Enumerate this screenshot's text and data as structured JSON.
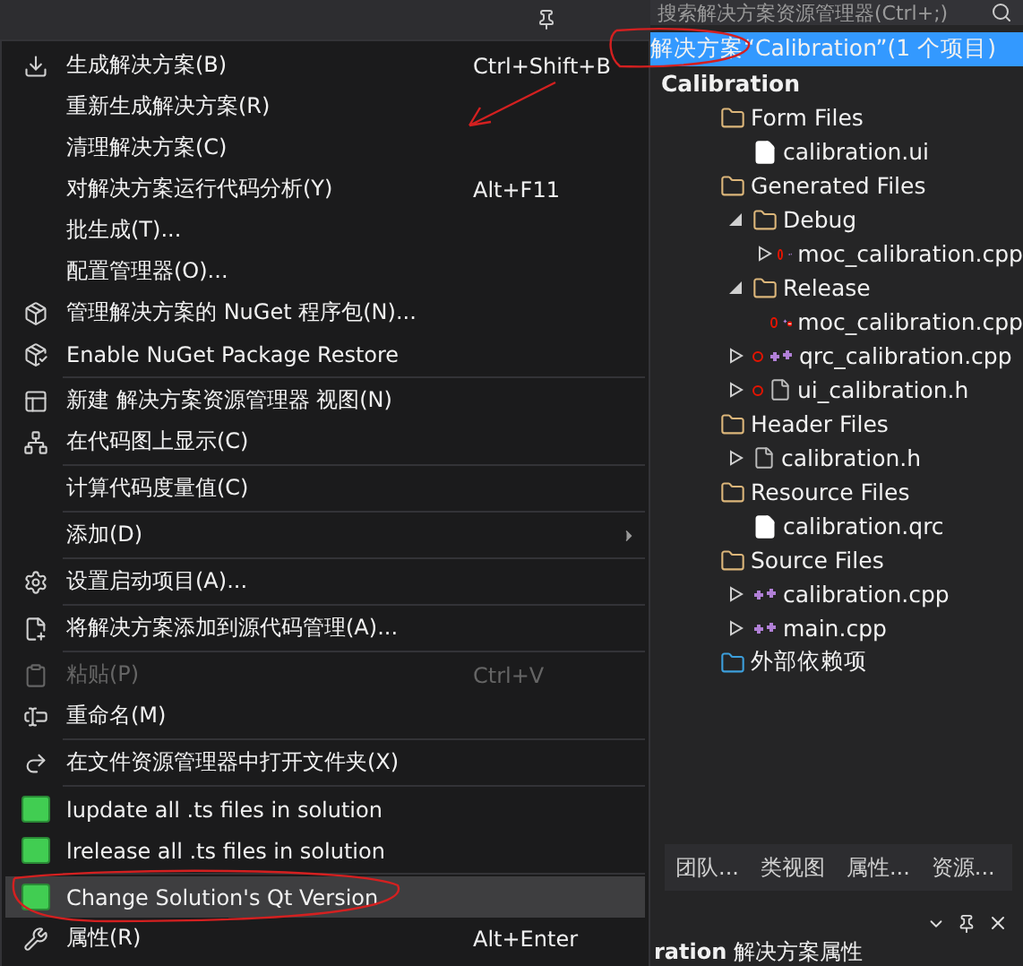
{
  "menu": {
    "items": [
      {
        "kind": "build",
        "label": "生成解决方案(B)",
        "shortcut": "Ctrl+Shift+B",
        "disabled": false,
        "selected": false
      },
      {
        "kind": "plain",
        "label": "重新生成解决方案(R)",
        "disabled": false,
        "selected": false
      },
      {
        "kind": "plain",
        "label": "清理解决方案(C)",
        "disabled": false,
        "selected": false
      },
      {
        "kind": "plain",
        "label": "对解决方案运行代码分析(Y)",
        "shortcut": "Alt+F11",
        "disabled": false,
        "selected": false
      },
      {
        "kind": "plain",
        "label": "批生成(T)...",
        "disabled": false,
        "selected": false
      },
      {
        "kind": "plain",
        "label": "配置管理器(O)...",
        "disabled": false,
        "selected": false
      },
      {
        "kind": "nuget",
        "label": "管理解决方案的 NuGet 程序包(N)...",
        "disabled": false,
        "selected": false
      },
      {
        "kind": "restore",
        "label": "Enable NuGet Package Restore",
        "disabled": false,
        "selected": false
      },
      {
        "kind": "separator"
      },
      {
        "kind": "view",
        "label": "新建 解决方案资源管理器 视图(N)",
        "disabled": false,
        "selected": false
      },
      {
        "kind": "codemap",
        "label": "在代码图上显示(C)",
        "disabled": false,
        "selected": false
      },
      {
        "kind": "separator"
      },
      {
        "kind": "plain",
        "label": "计算代码度量值(C)",
        "disabled": false,
        "selected": false
      },
      {
        "kind": "separator"
      },
      {
        "kind": "submenu",
        "label": "添加(D)",
        "disabled": false,
        "selected": false
      },
      {
        "kind": "separator"
      },
      {
        "kind": "gear",
        "label": "设置启动项目(A)...",
        "disabled": false,
        "selected": false
      },
      {
        "kind": "separator"
      },
      {
        "kind": "source",
        "label": "将解决方案添加到源代码管理(A)...",
        "disabled": false,
        "selected": false
      },
      {
        "kind": "separator"
      },
      {
        "kind": "paste",
        "label": "粘贴(P)",
        "shortcut": "Ctrl+V",
        "disabled": true,
        "selected": false
      },
      {
        "kind": "rename",
        "label": "重命名(M)",
        "disabled": false,
        "selected": false
      },
      {
        "kind": "separator"
      },
      {
        "kind": "folder",
        "label": "在文件资源管理器中打开文件夹(X)",
        "disabled": false,
        "selected": false
      },
      {
        "kind": "separator"
      },
      {
        "kind": "qt",
        "label": "lupdate all .ts files in solution",
        "disabled": false,
        "selected": false
      },
      {
        "kind": "qt",
        "label": "lrelease all .ts files in solution",
        "disabled": false,
        "selected": false
      },
      {
        "kind": "separator"
      },
      {
        "kind": "qt",
        "label": "Change Solution's Qt Version",
        "disabled": false,
        "selected": true
      },
      {
        "kind": "wrench",
        "label": "属性(R)",
        "shortcut": "Alt+Enter",
        "disabled": false,
        "selected": false
      }
    ]
  },
  "solution_explorer": {
    "search": {
      "placeholder": "搜索解决方案资源管理器(Ctrl+;)"
    },
    "tree": [
      {
        "label": "解决方案“Calibration”(1 个项目)",
        "selected": true,
        "children": [
          {
            "kind": "project",
            "label": "Calibration",
            "selected": false,
            "children": [
              {
                "kind": "folder",
                "label": "Form Files",
                "selected": false,
                "children": [
                  {
                    "kind": "ui",
                    "label": "calibration.ui",
                    "selected": false
                  }
                ]
              },
              {
                "kind": "folder",
                "label": "Generated Files",
                "selected": false,
                "children": [
                  {
                    "kind": "folder",
                    "label": "Debug",
                    "expanded": true,
                    "selected": false,
                    "children": [
                      {
                        "kind": "cpp",
                        "label": "moc_calibration.cpp",
                        "expanded": false,
                        "marked": true,
                        "selected": false
                      }
                    ]
                  },
                  {
                    "kind": "folder",
                    "label": "Release",
                    "expanded": true,
                    "selected": false,
                    "children": [
                      {
                        "kind": "cpp-excluded",
                        "label": "moc_calibration.cpp",
                        "marked": true,
                        "selected": false
                      }
                    ]
                  },
                  {
                    "kind": "cpp",
                    "label": "qrc_calibration.cpp",
                    "expanded": false,
                    "marked": true,
                    "selected": false
                  },
                  {
                    "kind": "header",
                    "label": "ui_calibration.h",
                    "expanded": false,
                    "marked": true,
                    "selected": false
                  }
                ]
              },
              {
                "kind": "folder",
                "label": "Header Files",
                "selected": false,
                "children": [
                  {
                    "kind": "header",
                    "label": "calibration.h",
                    "expanded": false,
                    "selected": false
                  }
                ]
              },
              {
                "kind": "folder",
                "label": "Resource Files",
                "selected": false,
                "children": [
                  {
                    "kind": "file",
                    "label": "calibration.qrc",
                    "selected": false
                  }
                ]
              },
              {
                "kind": "folder",
                "label": "Source Files",
                "selected": false,
                "children": [
                  {
                    "kind": "cpp",
                    "label": "calibration.cpp",
                    "expanded": false,
                    "selected": false
                  },
                  {
                    "kind": "cpp",
                    "label": "main.cpp",
                    "expanded": false,
                    "selected": false
                  }
                ]
              },
              {
                "kind": "deps",
                "label": "外部依赖项",
                "selected": false
              }
            ]
          }
        ]
      }
    ]
  },
  "tabs": [
    {
      "label": "团队...",
      "selected": false
    },
    {
      "label": "类视图",
      "selected": false
    },
    {
      "label": "属性...",
      "selected": false
    },
    {
      "label": "资源...",
      "selected": false
    }
  ],
  "properties": {
    "object": "ration",
    "title": "解决方案属性"
  }
}
